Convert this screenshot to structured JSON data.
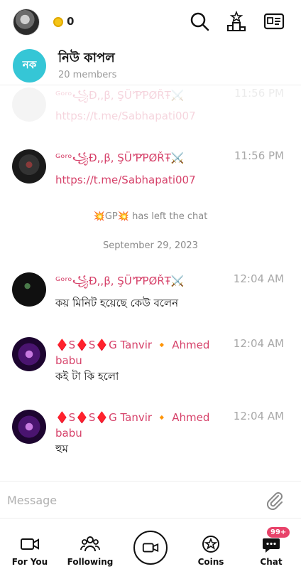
{
  "topbar": {
    "coins": "0"
  },
  "header": {
    "avatar_text": "নক",
    "title": "নিউ কাপল",
    "members": "20 members"
  },
  "messages": [
    {
      "sender": "ᴳᵒʳᵒ꧁Đ,,β, ŞÜ'ƤƤØŘŦ⚔️",
      "time": "11:56 PM",
      "text": "https://t.me/Sabhapati007",
      "faded": true
    },
    {
      "sender": "ᴳᵒʳᵒ꧁Đ,,β, ŞÜ'ƤƤØŘŦ⚔️",
      "time": "11:56 PM",
      "text": "https://t.me/Sabhapati007"
    },
    {
      "system": "💥GP💥 has left the chat"
    },
    {
      "system": "September 29, 2023"
    },
    {
      "sender": "ᴳᵒʳᵒ꧁Đ,,β, ŞÜ'ƤƤØŘŦ⚔️",
      "time": "12:04 AM",
      "text": "কয় মিনিট  হয়েছে  কেউ  বলেন"
    },
    {
      "sender": "♦️S♦️S♦️G Tanvir 🔸 Ahmed babu",
      "time": "12:04 AM",
      "text": "কই টা কি হলো"
    },
    {
      "sender": "♦️S♦️S♦️G Tanvir 🔸 Ahmed babu",
      "time": "12:04 AM",
      "text": "হুম"
    }
  ],
  "composer": {
    "placeholder": "Message"
  },
  "nav": {
    "for_you": "For You",
    "following": "Following",
    "coins": "Coins",
    "chat": "Chat",
    "chat_badge": "99+"
  }
}
